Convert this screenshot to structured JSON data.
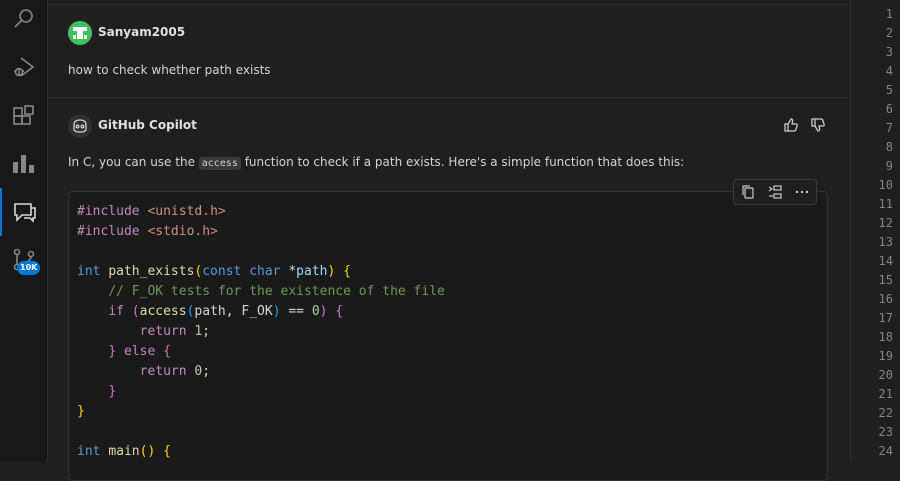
{
  "user_message": {
    "username": "Sanyam2005",
    "text": "how to check whether path exists"
  },
  "copilot_message": {
    "name": "GitHub Copilot",
    "answer_before": "In C, you can use the ",
    "answer_code": "access",
    "answer_after": " function to check if a path exists. Here's a simple function that does this:"
  },
  "activity_bar": {
    "items": [
      "search-icon",
      "run-debug-icon",
      "extensions-icon",
      "chart-icon",
      "chat-icon",
      "source-control-icon"
    ],
    "badge": "10K"
  },
  "code_lines": [
    "#include <unistd.h>",
    "#include <stdio.h>",
    "",
    "int path_exists(const char *path) {",
    "    // F_OK tests for the existence of the file",
    "    if (access(path, F_OK) == 0) {",
    "        return 1;",
    "    } else {",
    "        return 0;",
    "    }",
    "}",
    "",
    "int main() {"
  ],
  "line_numbers": [
    "1",
    "2",
    "3",
    "4",
    "5",
    "6",
    "7",
    "8",
    "9",
    "10",
    "11",
    "12",
    "13",
    "14",
    "15",
    "16",
    "17",
    "18",
    "19",
    "20",
    "21",
    "22",
    "23",
    "24"
  ],
  "colors": {
    "accent": "#0078d4",
    "background": "#1f1f1f",
    "user_avatar": "#3ec15a"
  }
}
